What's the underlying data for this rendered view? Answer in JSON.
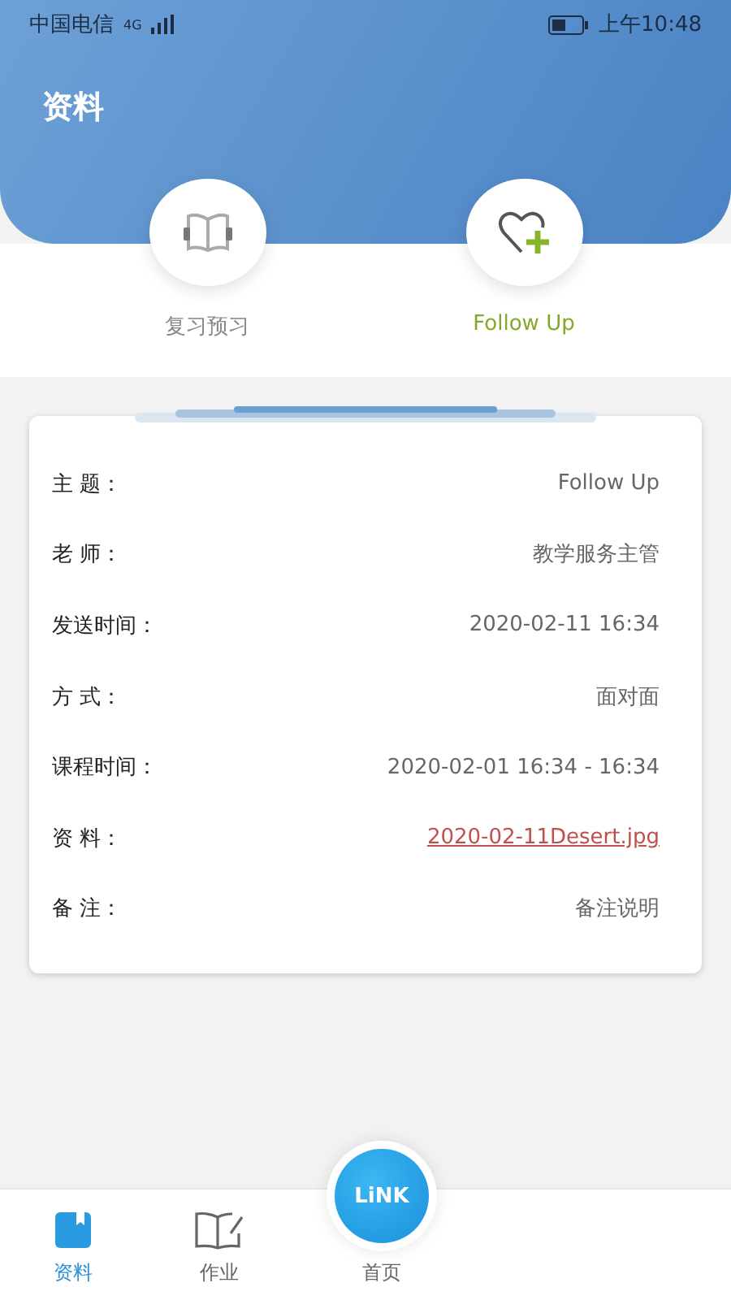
{
  "status_bar": {
    "carrier": "中国电信",
    "network": "4G",
    "time": "上午10:48"
  },
  "header": {
    "title": "资料"
  },
  "tabs": [
    {
      "label": "复习预习",
      "kind": "book",
      "selected": false
    },
    {
      "label": "Follow Up",
      "kind": "heart",
      "selected": true
    }
  ],
  "details": [
    {
      "label": "主 题：",
      "value": "Follow Up",
      "kind": "text"
    },
    {
      "label": "老 师：",
      "value": "教学服务主管",
      "kind": "text"
    },
    {
      "label": "发送时间：",
      "value": "2020-02-11 16:34",
      "kind": "text"
    },
    {
      "label": "方 式：",
      "value": "面对面",
      "kind": "text"
    },
    {
      "label": "课程时间：",
      "value": "2020-02-01 16:34 - 16:34",
      "kind": "text"
    },
    {
      "label": "资 料：",
      "value": "2020-02-11Desert.jpg",
      "kind": "link"
    },
    {
      "label": "备 注：",
      "value": "备注说明",
      "kind": "text"
    }
  ],
  "bottom_nav": [
    {
      "label": "资料",
      "kind": "materials",
      "selected": true
    },
    {
      "label": "作业",
      "kind": "homework",
      "selected": false
    },
    {
      "label": "首页",
      "kind": "home",
      "badge": "LiNK",
      "selected": false
    }
  ]
}
